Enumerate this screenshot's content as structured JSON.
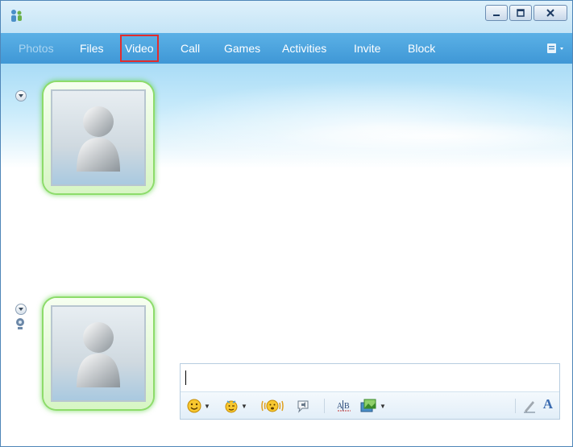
{
  "menu": {
    "items": [
      {
        "label": "Photos",
        "state": "disabled"
      },
      {
        "label": "Files",
        "state": "normal"
      },
      {
        "label": "Video",
        "state": "selected"
      },
      {
        "label": "Call",
        "state": "normal"
      },
      {
        "label": "Games",
        "state": "normal"
      },
      {
        "label": "Activities",
        "state": "normal"
      },
      {
        "label": "Invite",
        "state": "normal"
      },
      {
        "label": "Block",
        "state": "normal"
      }
    ],
    "highlight_color": "#e22c2c"
  },
  "window_controls": {
    "minimize_icon": "minimize-icon",
    "maximize_icon": "maximize-icon",
    "close_icon": "close-icon"
  },
  "message_input": {
    "value": ""
  },
  "toolbar_icons": [
    "emoticon-icon",
    "wink-icon",
    "nudge-icon",
    "voice-clip-icon",
    "spell-check-icon",
    "background-icon",
    "handwriting-icon",
    "font-icon"
  ],
  "font_button": {
    "label": "A"
  },
  "colors": {
    "menubar": "#4aa3de",
    "avatar_glow": "#5ad23c"
  }
}
